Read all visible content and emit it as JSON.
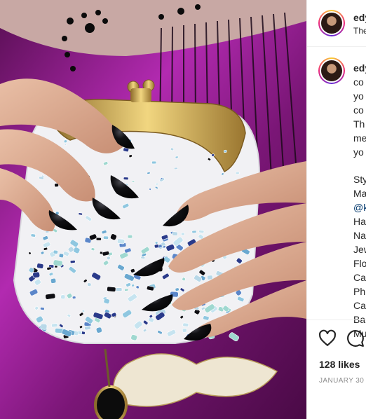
{
  "post": {
    "username": "edy",
    "header_subtitle": "The",
    "caption_lines": [
      "co",
      "yo",
      "co",
      "Th",
      "me",
      "yo"
    ],
    "credit_lines": [
      "Sty",
      "Ma",
      "@k",
      "Ha",
      "Na",
      "Jew",
      "Flo",
      "Ca",
      "Ph",
      "Ca",
      "Ba",
      "Mu"
    ],
    "likes": "128 likes",
    "date": "JANUARY 30"
  },
  "icons": {
    "like": "heart-icon",
    "comment": "comment-icon"
  },
  "colors": {
    "avatar_ring": "#ee2a7b",
    "mention": "#00376b",
    "secondary_text": "#8e8e8e",
    "dress_purple": "#8b1f8a",
    "nail_black": "#0d0d0f",
    "clutch_gold": "#c9a24a"
  }
}
